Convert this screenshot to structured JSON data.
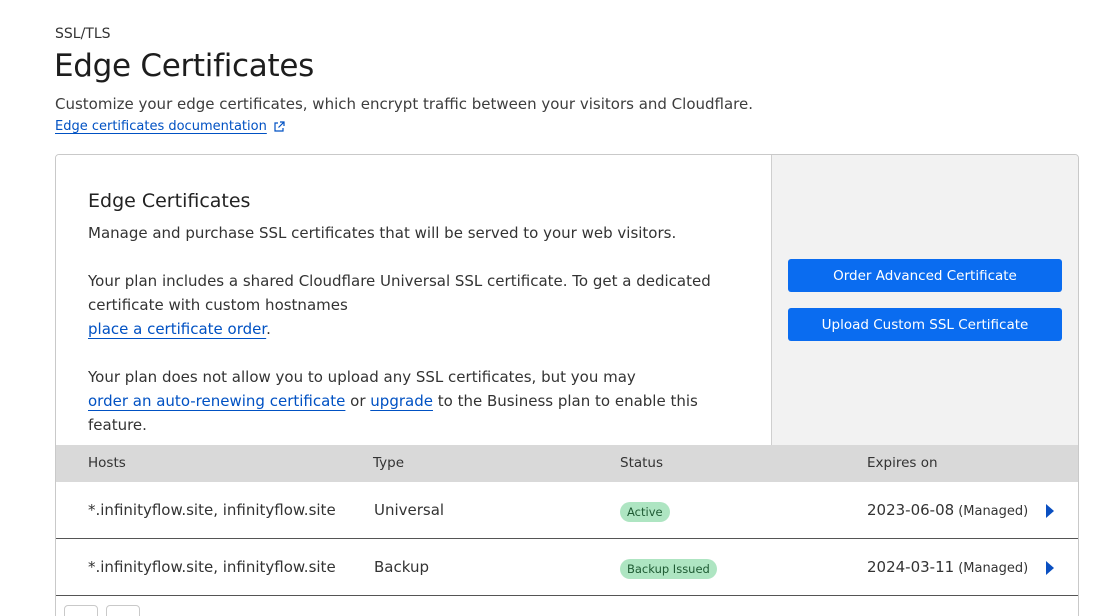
{
  "breadcrumb": "SSL/TLS",
  "page": {
    "title": "Edge Certificates",
    "description": "Customize your edge certificates, which encrypt traffic between your visitors and Cloudflare.",
    "doc_link": "Edge certificates documentation"
  },
  "card": {
    "title": "Edge Certificates",
    "intro": "Manage and purchase SSL certificates that will be served to your web visitors.",
    "plan_text": "Your plan includes a shared Cloudflare Universal SSL certificate. To get a dedicated certificate with custom hostnames",
    "plan_link": "place a certificate order",
    "plan_link_suffix": ".",
    "upload_text": "Your plan does not allow you to upload any SSL certificates, but you may",
    "upload_link1": "order an auto-renewing certificate",
    "upload_or": " or ",
    "upload_link2": "upgrade",
    "upload_suffix": " to the Business plan to enable this feature.",
    "buttons": {
      "order_advanced": "Order Advanced Certificate",
      "upload_custom": "Upload Custom SSL Certificate"
    }
  },
  "table": {
    "headers": {
      "hosts": "Hosts",
      "type": "Type",
      "status": "Status",
      "expires": "Expires on"
    },
    "rows": [
      {
        "hosts": "*.infinityflow.site, infinityflow.site",
        "type": "Universal",
        "status": "Active",
        "expires": "2023-06-08",
        "managed": "(Managed)"
      },
      {
        "hosts": "*.infinityflow.site, infinityflow.site",
        "type": "Backup",
        "status": "Backup Issued",
        "expires": "2024-03-11",
        "managed": "(Managed)"
      }
    ]
  },
  "colors": {
    "link": "#0051c3",
    "button": "#0a6cf0",
    "badge_bg": "#aee5c2",
    "header_bg": "#d9d9d9"
  }
}
